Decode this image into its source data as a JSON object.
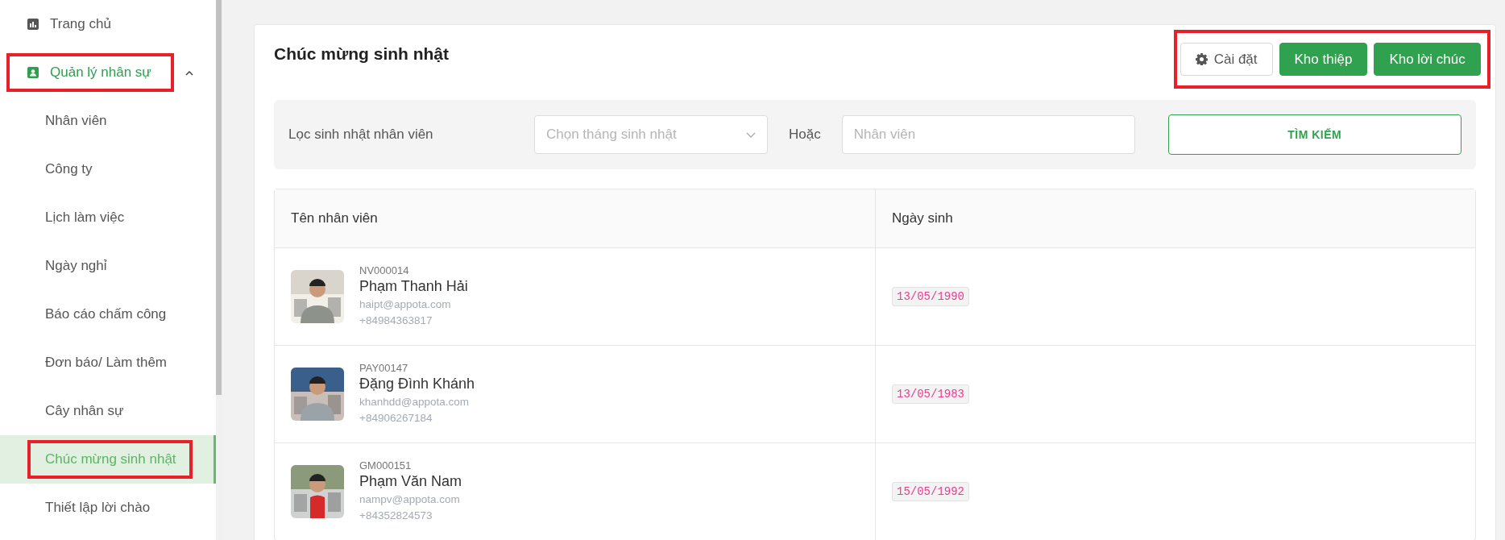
{
  "sidebar": {
    "items": [
      {
        "label": "Trang chủ",
        "selected": false,
        "highlighted": false
      },
      {
        "label": "Quản lý nhân sự",
        "selected": true,
        "highlighted": true,
        "expanded": true,
        "children": [
          {
            "label": "Nhân viên",
            "selected": false,
            "highlighted": false
          },
          {
            "label": "Công ty",
            "selected": false,
            "highlighted": false
          },
          {
            "label": "Lịch làm việc",
            "selected": false,
            "highlighted": false
          },
          {
            "label": "Ngày nghỉ",
            "selected": false,
            "highlighted": false
          },
          {
            "label": "Báo cáo chấm công",
            "selected": false,
            "highlighted": false
          },
          {
            "label": "Đơn báo/ Làm thêm",
            "selected": false,
            "highlighted": false
          },
          {
            "label": "Cây nhân sự",
            "selected": false,
            "highlighted": false
          },
          {
            "label": "Chúc mừng sinh nhật",
            "selected": true,
            "highlighted": true
          },
          {
            "label": "Thiết lập lời chào",
            "selected": false,
            "highlighted": false
          }
        ]
      }
    ]
  },
  "page": {
    "title": "Chúc mừng sinh nhật",
    "actions_highlighted": true,
    "actions": [
      {
        "label": "Cài đặt",
        "kind": "outline"
      },
      {
        "label": "Kho thiệp",
        "kind": "primary"
      },
      {
        "label": "Kho lời chúc",
        "kind": "primary"
      }
    ]
  },
  "filter": {
    "label": "Lọc sinh nhật nhân viên",
    "month_select": {
      "placeholder": "Chọn tháng sinh nhật"
    },
    "or_label": "Hoặc",
    "employee_field": {
      "placeholder": "Nhân viên"
    },
    "search_button": "TÌM KIẾM"
  },
  "table": {
    "columns": [
      "Tên nhân viên",
      "Ngày sinh"
    ],
    "rows": [
      {
        "code": "NV000014",
        "name": "Phạm Thanh Hải",
        "email": "haipt@appota.com",
        "phone": "+84984363817",
        "birthday": "13/05/1990"
      },
      {
        "code": "PAY00147",
        "name": "Đặng Đình Khánh",
        "email": "khanhdd@appota.com",
        "phone": "+84906267184",
        "birthday": "13/05/1983"
      },
      {
        "code": "GM000151",
        "name": "Phạm Văn Nam",
        "email": "nampv@appota.com",
        "phone": "+84352824573",
        "birthday": "15/05/1992"
      }
    ]
  }
}
